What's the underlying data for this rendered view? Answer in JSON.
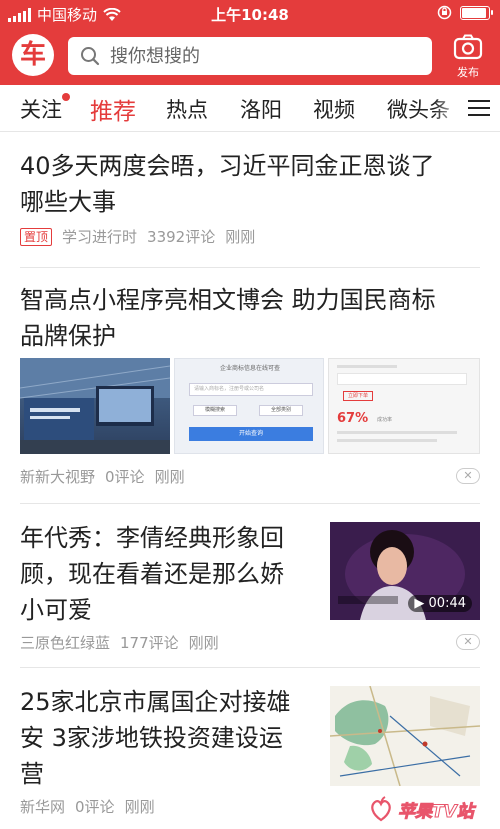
{
  "status_bar": {
    "carrier": "中国移动",
    "time": "上午10:48"
  },
  "header": {
    "logo_text": "车",
    "search_placeholder": "搜你想搜的",
    "publish_label": "发布"
  },
  "tabs": [
    {
      "label": "关注"
    },
    {
      "label": "推荐"
    },
    {
      "label": "热点"
    },
    {
      "label": "洛阳"
    },
    {
      "label": "视频"
    },
    {
      "label": "微头条"
    }
  ],
  "articles": [
    {
      "title_lines": [
        "40多天两度会晤，习近平同金正恩谈了",
        "哪些大事"
      ],
      "badge": "置顶",
      "source": "学习进行时",
      "comments": "3392评论",
      "time": "刚刚"
    },
    {
      "title_lines": [
        "智高点小程序亮相文博会 助力国民商标",
        "品牌保护"
      ],
      "source": "新新大视野",
      "comments": "0评论",
      "time": "刚刚",
      "image_text": {
        "panel2_heading": "企业商标信息在线可查",
        "panel2_input": "请输入商标名，注册号或公司名",
        "panel2_btn1": "模糊搜索",
        "panel2_btn2": "全部类别",
        "panel2_btn3": "开始查询",
        "panel3_link": "立即下单",
        "panel3_percent": "67%",
        "panel3_rate": "成功率"
      }
    },
    {
      "title_lines": [
        "年代秀：李倩经典形象回",
        "顾，现在看着还是那么娇",
        "小可爱"
      ],
      "source": "三原色红绿蓝",
      "comments": "177评论",
      "time": "刚刚",
      "video_duration": "00:44"
    },
    {
      "title_lines": [
        "25家北京市属国企对接雄",
        "安 3家涉地铁投资建设运",
        "营"
      ],
      "source": "新华网",
      "comments": "0评论",
      "time": "刚刚"
    }
  ],
  "watermark": "苹果TV站",
  "colors": {
    "brand_red": "#e43c3c",
    "meta_gray": "#999999"
  }
}
